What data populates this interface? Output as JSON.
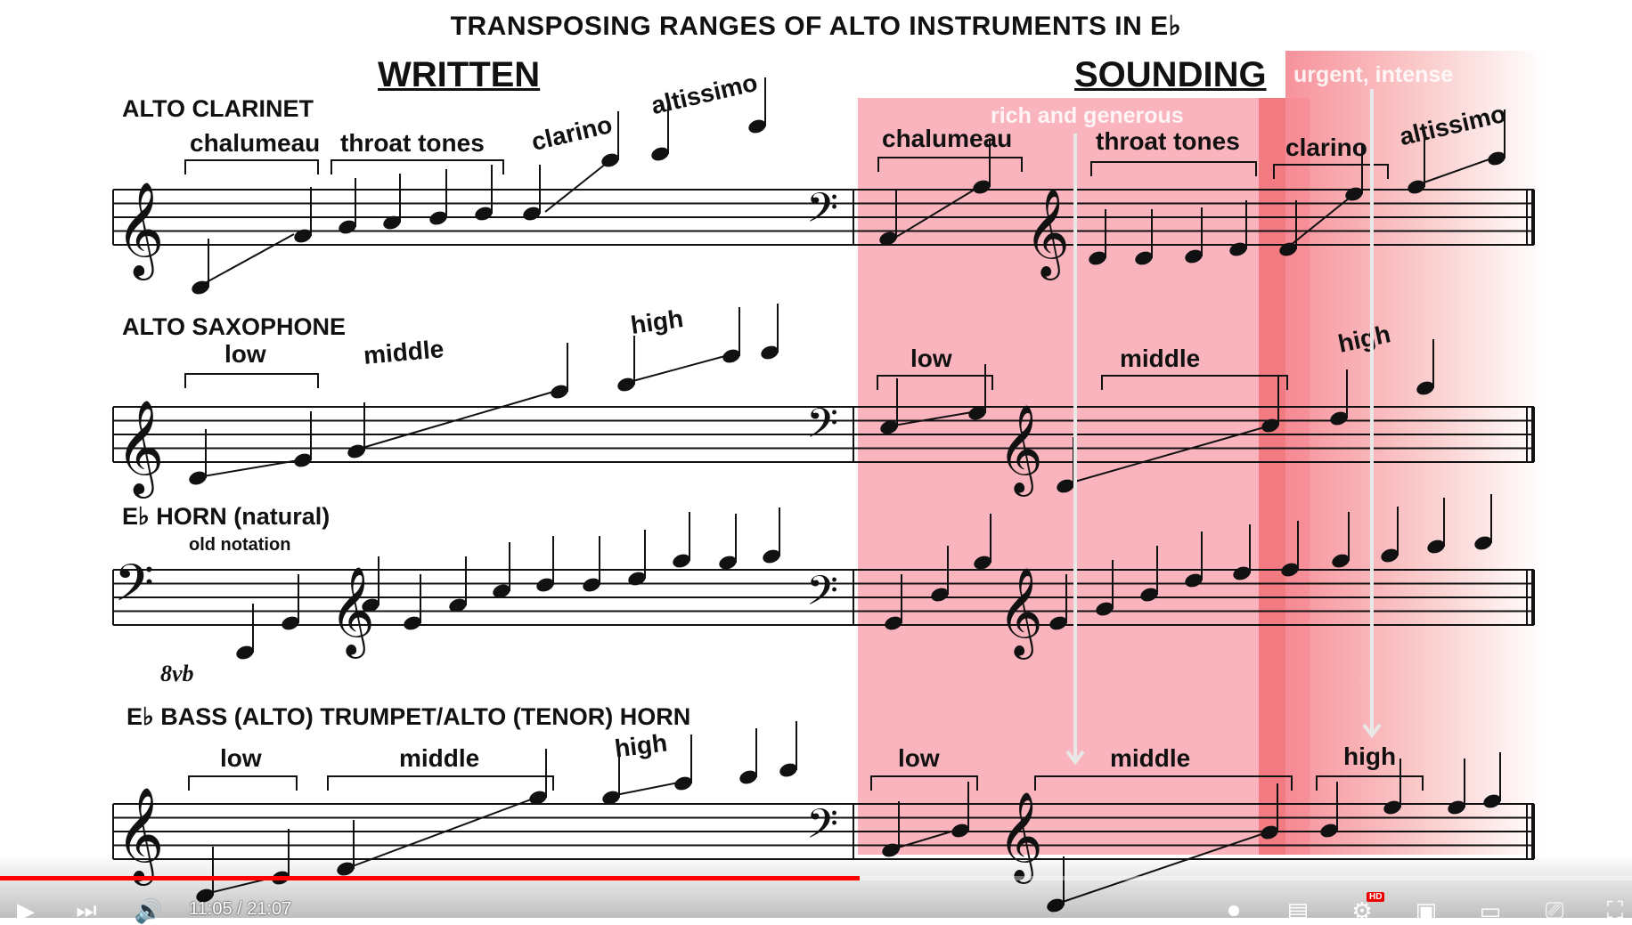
{
  "title": "TRANSPOSING RANGES OF ALTO INSTRUMENTS IN E♭",
  "headings": {
    "written": "WRITTEN",
    "sounding": "SOUNDING"
  },
  "bands": {
    "rich": "rich and generous",
    "urgent": "urgent, intense",
    "colors": {
      "pink": "#f8a7b1",
      "red": "#f06d73",
      "fade": "#f9b8b8"
    }
  },
  "instruments": [
    {
      "name": "ALTO CLARINET",
      "written": [
        "chalumeau",
        "throat tones",
        "clarino",
        "altissimo"
      ],
      "sounding": [
        "chalumeau",
        "throat tones",
        "clarino",
        "altissimo"
      ]
    },
    {
      "name": "ALTO SAXOPHONE",
      "written": [
        "low",
        "middle",
        "high"
      ],
      "sounding": [
        "low",
        "middle",
        "high"
      ]
    },
    {
      "name": "E♭ HORN (natural)",
      "old_notation": "old notation",
      "octave_mark": "8vb"
    },
    {
      "name": "E♭ BASS (ALTO) TRUMPET/ALTO (TENOR) HORN",
      "written": [
        "low",
        "middle",
        "high"
      ],
      "sounding": [
        "low",
        "middle",
        "high"
      ]
    }
  ],
  "player": {
    "time": "11:05 / 21:07",
    "progress": 0.527,
    "hd_badge": "HD",
    "icons": [
      "play-icon",
      "next-icon",
      "volume-icon",
      "autoplay-icon",
      "subtitles-icon",
      "settings-icon",
      "miniplayer-icon",
      "theater-icon",
      "cast-icon",
      "fullscreen-icon"
    ]
  }
}
